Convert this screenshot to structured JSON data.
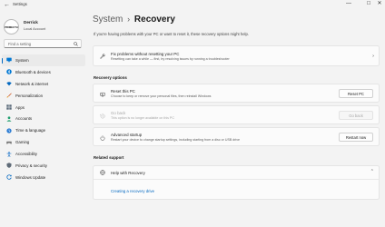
{
  "window": {
    "title": "Settings",
    "controls": {
      "minimize": "—",
      "maximize": "☐",
      "close": "✕"
    }
  },
  "profile": {
    "avatar_text": "PRIMECTH",
    "name": "Derrick",
    "account_type": "Local Account"
  },
  "search": {
    "placeholder": "Find a setting"
  },
  "sidebar": {
    "selected": "System",
    "items": [
      {
        "label": "System",
        "icon": "monitor-icon",
        "color": "#0078d4"
      },
      {
        "label": "Bluetooth & devices",
        "icon": "bluetooth-icon",
        "color": "#0078d4"
      },
      {
        "label": "Network & internet",
        "icon": "wifi-icon",
        "color": "#0067c0"
      },
      {
        "label": "Personalization",
        "icon": "brush-icon",
        "color": "#d05c2b"
      },
      {
        "label": "Apps",
        "icon": "apps-icon",
        "color": "#5b6a7a"
      },
      {
        "label": "Accounts",
        "icon": "person-icon",
        "color": "#1f9e6e"
      },
      {
        "label": "Time & language",
        "icon": "globe-clock-icon",
        "color": "#2b7cd3"
      },
      {
        "label": "Gaming",
        "icon": "controller-icon",
        "color": "#7a7a7a"
      },
      {
        "label": "Accessibility",
        "icon": "accessibility-icon",
        "color": "#1a73c8"
      },
      {
        "label": "Privacy & security",
        "icon": "shield-icon",
        "color": "#5f6b78"
      },
      {
        "label": "Windows Update",
        "icon": "update-icon",
        "color": "#0067c0"
      }
    ]
  },
  "breadcrumb": {
    "parent": "System",
    "separator": "›",
    "current": "Recovery"
  },
  "intro": "If you're having problems with your PC or want to reset it, these recovery options might help.",
  "fix_card": {
    "title": "Fix problems without resetting your PC",
    "description": "Resetting can take a while — first, try resolving issues by running a troubleshooter"
  },
  "recovery_options": {
    "heading": "Recovery options",
    "reset": {
      "title": "Reset this PC",
      "description": "Choose to keep or remove your personal files, then reinstall Windows",
      "button": "Reset PC"
    },
    "go_back": {
      "title": "Go back",
      "description": "This option is no longer available on this PC",
      "button": "Go back"
    },
    "advanced": {
      "title": "Advanced startup",
      "description": "Restart your device to change startup settings, including starting from a disc or USB drive",
      "button": "Restart now"
    }
  },
  "related_support": {
    "heading": "Related support",
    "help_title": "Help with Recovery",
    "link": "Creating a recovery drive"
  },
  "colors": {
    "accent": "#0067c0",
    "background": "#f3f3f3",
    "card": "#fbfbfb"
  }
}
